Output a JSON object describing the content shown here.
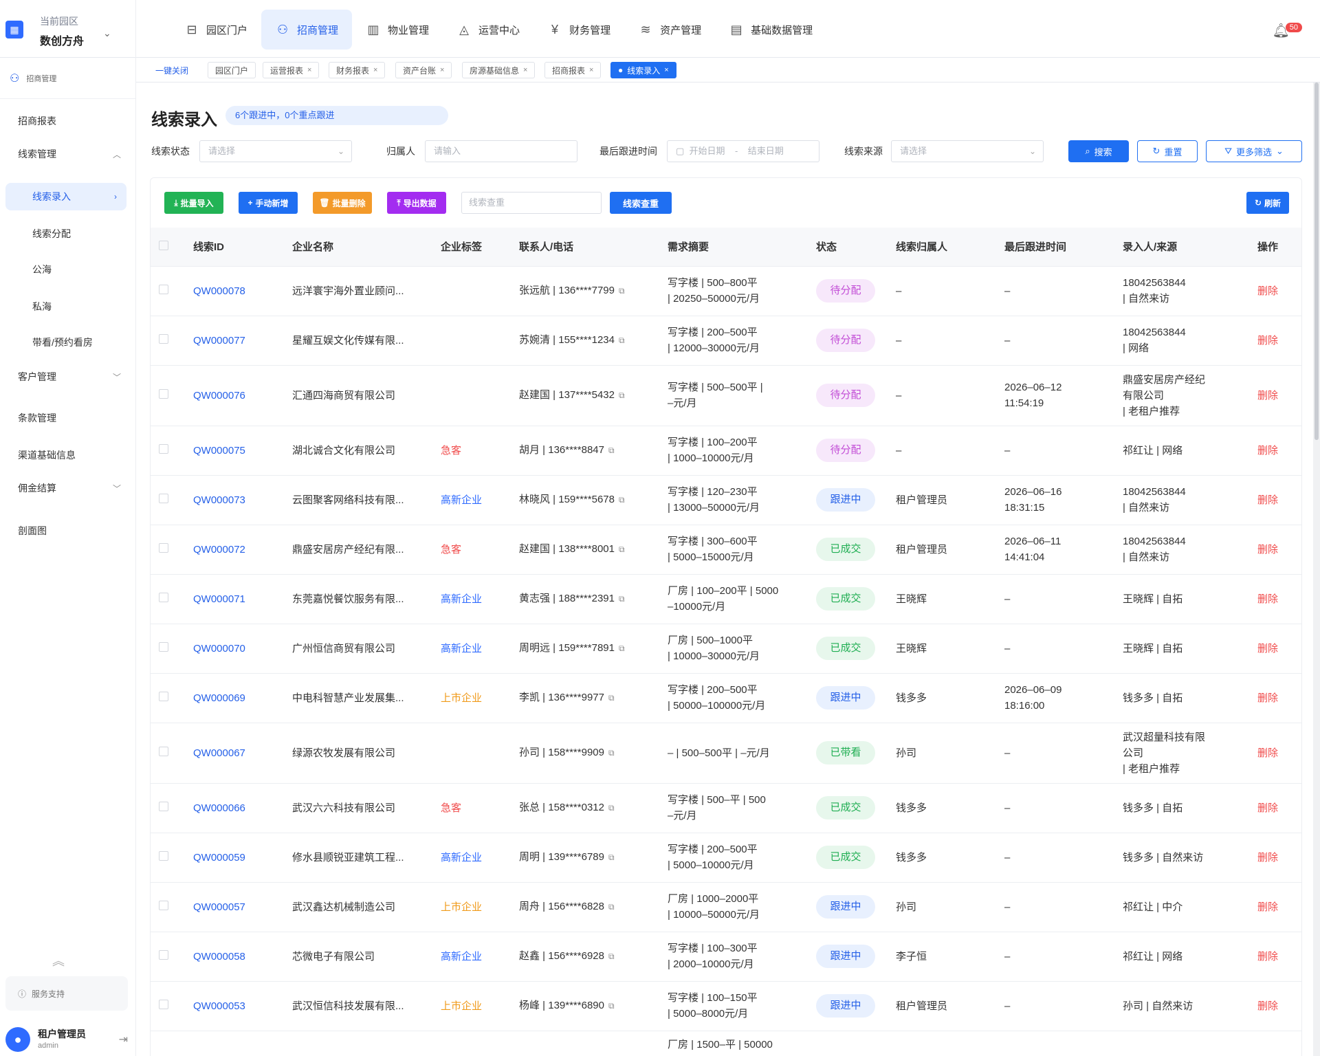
{
  "header": {
    "park_caption": "当前园区",
    "park_name": "数创方舟",
    "nav": [
      {
        "label": "园区门户",
        "icon": "portal-icon"
      },
      {
        "label": "招商管理",
        "icon": "users-icon",
        "active": true
      },
      {
        "label": "物业管理",
        "icon": "building-icon"
      },
      {
        "label": "运营中心",
        "icon": "operations-icon"
      },
      {
        "label": "财务管理",
        "icon": "yen-icon"
      },
      {
        "label": "资产管理",
        "icon": "layers-icon"
      },
      {
        "label": "基础数据管理",
        "icon": "database-icon"
      }
    ],
    "notification_count": "50"
  },
  "sidebar": {
    "head": "招商管理",
    "items": [
      {
        "label": "招商报表"
      },
      {
        "label": "线索管理"
      },
      {
        "label": "线索录入"
      },
      {
        "label": "线索分配"
      },
      {
        "label": "公海"
      },
      {
        "label": "私海"
      },
      {
        "label": "带看/预约看房"
      },
      {
        "label": "客户管理"
      },
      {
        "label": "条款管理"
      },
      {
        "label": "渠道基础信息"
      },
      {
        "label": "佣金结算"
      },
      {
        "label": "剖面图"
      }
    ],
    "support": "服务支持",
    "user_name": "租户管理员",
    "user_role": "admin"
  },
  "tabs": {
    "close_all": "一键关闭",
    "items": [
      "园区门户",
      "运营报表",
      "财务报表",
      "资产台账",
      "房源基础信息",
      "招商报表",
      "线索录入"
    ]
  },
  "page": {
    "title": "线索录入",
    "summary": "6个跟进中，0个重点跟进"
  },
  "filters": {
    "status_label": "线索状态",
    "status_placeholder": "请选择",
    "owner_label": "归属人",
    "owner_placeholder": "请输入",
    "last_follow_label": "最后跟进时间",
    "start_placeholder": "开始日期",
    "range_sep": "-",
    "end_placeholder": "结束日期",
    "source_label": "线索来源",
    "source_placeholder": "请选择",
    "search": "搜索",
    "reset": "重置",
    "more": "更多筛选"
  },
  "actions": {
    "batch_import": "批量导入",
    "manual_add": "手动新增",
    "batch_delete": "批量删除",
    "export": "导出数据",
    "dedup_placeholder": "线索查重",
    "dedup": "线索查重",
    "refresh": "刷新"
  },
  "table": {
    "columns": [
      "线索ID",
      "企业名称",
      "企业标签",
      "联系人/电话",
      "需求摘要",
      "状态",
      "线索归属人",
      "最后跟进时间",
      "录入人/来源",
      "操作"
    ],
    "rows": [
      {
        "id": "QW000078",
        "company": "远洋寰宇海外置业顾问...",
        "tag": "",
        "contact": "张远航 | 136****7799",
        "demand": [
          "写字楼 | 500–800平",
          "| 20250–50000元/月"
        ],
        "status": "待分配",
        "owner": "–",
        "last": [
          "–"
        ],
        "source": [
          "18042563844",
          "| 自然来访"
        ],
        "op": "删除"
      },
      {
        "id": "QW000077",
        "company": "星耀互娱文化传媒有限...",
        "tag": "",
        "contact": "苏婉清 | 155****1234",
        "demand": [
          "写字楼 | 200–500平",
          "| 12000–30000元/月"
        ],
        "status": "待分配",
        "owner": "–",
        "last": [
          "–"
        ],
        "source": [
          "18042563844",
          "| 网络"
        ],
        "op": "删除"
      },
      {
        "id": "QW000076",
        "company": "汇通四海商贸有限公司",
        "tag": "",
        "contact": "赵建国 | 137****5432",
        "demand": [
          "写字楼 | 500–500平 |",
          "–元/月"
        ],
        "status": "待分配",
        "owner": "–",
        "last": [
          "2026–06–12",
          "11:54:19"
        ],
        "source": [
          "鼎盛安居房产经纪",
          "有限公司",
          "| 老租户推荐"
        ],
        "op": "删除"
      },
      {
        "id": "QW000075",
        "company": "湖北诚合文化有限公司",
        "tag": "急客",
        "contact": "胡月 | 136****8847",
        "demand": [
          "写字楼 | 100–200平",
          "| 1000–10000元/月"
        ],
        "status": "待分配",
        "owner": "–",
        "last": [
          "–"
        ],
        "source": [
          "祁红让 | 网络"
        ],
        "op": "删除"
      },
      {
        "id": "QW000073",
        "company": "云图聚客网络科技有限...",
        "tag": "高新企业",
        "contact": "林晓风 | 159****5678",
        "demand": [
          "写字楼 | 120–230平",
          "| 13000–50000元/月"
        ],
        "status": "跟进中",
        "owner": "租户管理员",
        "last": [
          "2026–06–16",
          "18:31:15"
        ],
        "source": [
          "18042563844",
          "| 自然来访"
        ],
        "op": "删除"
      },
      {
        "id": "QW000072",
        "company": "鼎盛安居房产经纪有限...",
        "tag": "急客",
        "contact": "赵建国 | 138****8001",
        "demand": [
          "写字楼 | 300–600平",
          "| 5000–15000元/月"
        ],
        "status": "已成交",
        "owner": "租户管理员",
        "last": [
          "2026–06–11",
          "14:41:04"
        ],
        "source": [
          "18042563844",
          "| 自然来访"
        ],
        "op": "删除"
      },
      {
        "id": "QW000071",
        "company": "东莞嘉悦餐饮服务有限...",
        "tag": "高新企业",
        "contact": "黄志强 | 188****2391",
        "demand": [
          "厂房 | 100–200平 | 5000",
          "–10000元/月"
        ],
        "status": "已成交",
        "owner": "王晓辉",
        "last": [
          "–"
        ],
        "source": [
          "王晓辉 | 自拓"
        ],
        "op": "删除"
      },
      {
        "id": "QW000070",
        "company": "广州恒信商贸有限公司",
        "tag": "高新企业",
        "contact": "周明远 | 159****7891",
        "demand": [
          "厂房 | 500–1000平",
          "| 10000–30000元/月"
        ],
        "status": "已成交",
        "owner": "王晓辉",
        "last": [
          "–"
        ],
        "source": [
          "王晓辉 | 自拓"
        ],
        "op": "删除"
      },
      {
        "id": "QW000069",
        "company": "中电科智慧产业发展集...",
        "tag": "上市企业",
        "contact": "李凯 | 136****9977",
        "demand": [
          "写字楼 | 200–500平",
          "| 50000–100000元/月"
        ],
        "status": "跟进中",
        "owner": "钱多多",
        "last": [
          "2026–06–09",
          "18:16:00"
        ],
        "source": [
          "钱多多 | 自拓"
        ],
        "op": "删除"
      },
      {
        "id": "QW000067",
        "company": "绿源农牧发展有限公司",
        "tag": "",
        "contact": "孙司 | 158****9909",
        "demand": [
          "– | 500–500平 | –元/月"
        ],
        "status": "已带看",
        "owner": "孙司",
        "last": [
          "–"
        ],
        "source": [
          "武汉超量科技有限",
          "公司",
          "| 老租户推荐"
        ],
        "op": "删除"
      },
      {
        "id": "QW000066",
        "company": "武汉六六科技有限公司",
        "tag": "急客",
        "contact": "张总 | 158****0312",
        "demand": [
          "写字楼 | 500–平 | 500",
          "–元/月"
        ],
        "status": "已成交",
        "owner": "钱多多",
        "last": [
          "–"
        ],
        "source": [
          "钱多多 | 自拓"
        ],
        "op": "删除"
      },
      {
        "id": "QW000059",
        "company": "修水县顺锐亚建筑工程...",
        "tag": "高新企业",
        "contact": "周明 | 139****6789",
        "demand": [
          "写字楼 | 200–500平",
          "| 5000–10000元/月"
        ],
        "status": "已成交",
        "owner": "钱多多",
        "last": [
          "–"
        ],
        "source": [
          "钱多多 | 自然来访"
        ],
        "op": "删除"
      },
      {
        "id": "QW000057",
        "company": "武汉鑫达机械制造公司",
        "tag": "上市企业",
        "contact": "周舟 | 156****6828",
        "demand": [
          "厂房 | 1000–2000平",
          "| 10000–50000元/月"
        ],
        "status": "跟进中",
        "owner": "孙司",
        "last": [
          "–"
        ],
        "source": [
          "祁红让 | 中介"
        ],
        "op": "删除"
      },
      {
        "id": "QW000058",
        "company": "芯微电子有限公司",
        "tag": "高新企业",
        "contact": "赵鑫 | 156****6928",
        "demand": [
          "写字楼 | 100–300平",
          "| 2000–10000元/月"
        ],
        "status": "跟进中",
        "owner": "李子恒",
        "last": [
          "–"
        ],
        "source": [
          "祁红让 | 网络"
        ],
        "op": "删除"
      },
      {
        "id": "QW000053",
        "company": "武汉恒信科技发展有限...",
        "tag": "上市企业",
        "contact": "杨峰 | 139****6890",
        "demand": [
          "写字楼 | 100–150平",
          "| 5000–8000元/月"
        ],
        "status": "跟进中",
        "owner": "租户管理员",
        "last": [
          "–"
        ],
        "source": [
          "孙司 | 自然来访"
        ],
        "op": "删除"
      },
      {
        "id": "",
        "company": "",
        "tag": "",
        "contact": "",
        "demand": [
          "厂房 | 1500–平 | 50000"
        ],
        "status": "",
        "owner": "",
        "last": [
          ""
        ],
        "source": [
          ""
        ],
        "op": ""
      }
    ]
  },
  "colors": {
    "primary": "#1f6ff2",
    "tag_urgent": "#f04a4a",
    "tag_hightech": "#2f6bff",
    "tag_listed": "#f09a1a",
    "status_pending_bg": "#f7e8fb",
    "status_pending_fg": "#c24cd6",
    "status_following_bg": "#e8f0fe",
    "status_following_fg": "#2560e8",
    "status_deal_bg": "#e7f7ec",
    "status_deal_fg": "#1fae52",
    "delete": "#f04a4a"
  }
}
